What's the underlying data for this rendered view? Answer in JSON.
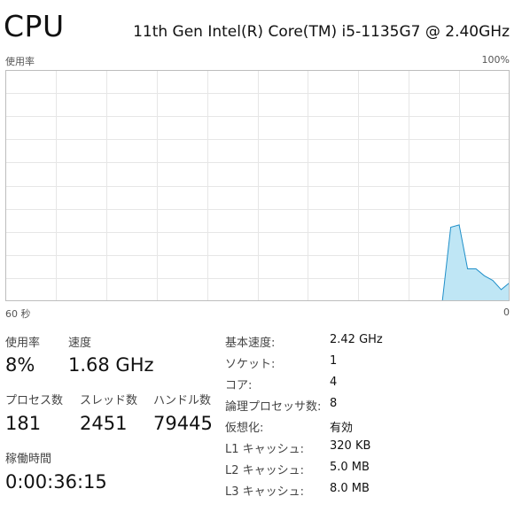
{
  "header": {
    "title": "CPU",
    "processor_model": "11th Gen Intel(R) Core(TM) i5-1135G7 @ 2.40GHz"
  },
  "graph": {
    "y_label": "使用率",
    "y_max_label": "100%",
    "x_left_label": "60 秒",
    "x_right_label": "0",
    "line_color": "#1f8fc9",
    "fill_color": "#bfe6f5",
    "grid_color": "#e6e6e6",
    "border_color": "#bdbdbd"
  },
  "chart_data": {
    "type": "area",
    "x": [
      60,
      58,
      56,
      54,
      52,
      50,
      48,
      46,
      44,
      42,
      40,
      38,
      36,
      34,
      32,
      30,
      28,
      26,
      24,
      22,
      20,
      18,
      16,
      14,
      12,
      10,
      8,
      7,
      6,
      5,
      4,
      3,
      2,
      1,
      0
    ],
    "values": [
      0,
      0,
      0,
      0,
      0,
      0,
      0,
      0,
      0,
      0,
      0,
      0,
      0,
      0,
      0,
      0,
      0,
      0,
      0,
      0,
      0,
      0,
      0,
      0,
      0,
      0,
      0,
      32,
      33,
      14,
      14,
      11,
      9,
      5,
      8
    ],
    "xlim": [
      60,
      0
    ],
    "ylim": [
      0,
      100
    ],
    "grid": true
  },
  "stats": {
    "usage": {
      "label": "使用率",
      "value": "8%"
    },
    "speed": {
      "label": "速度",
      "value": "1.68 GHz"
    },
    "processes": {
      "label": "プロセス数",
      "value": "181"
    },
    "threads": {
      "label": "スレッド数",
      "value": "2451"
    },
    "handles": {
      "label": "ハンドル数",
      "value": "79445"
    },
    "uptime": {
      "label": "稼働時間",
      "value": "0:00:36:15"
    }
  },
  "details": [
    {
      "label": "基本速度:",
      "value": "2.42 GHz"
    },
    {
      "label": "ソケット:",
      "value": "1"
    },
    {
      "label": "コア:",
      "value": "4"
    },
    {
      "label": "論理プロセッサ数:",
      "value": "8"
    },
    {
      "label": "仮想化:",
      "value": "有効"
    },
    {
      "label": "L1 キャッシュ:",
      "value": "320 KB"
    },
    {
      "label": "L2 キャッシュ:",
      "value": "5.0 MB"
    },
    {
      "label": "L3 キャッシュ:",
      "value": "8.0 MB"
    }
  ]
}
